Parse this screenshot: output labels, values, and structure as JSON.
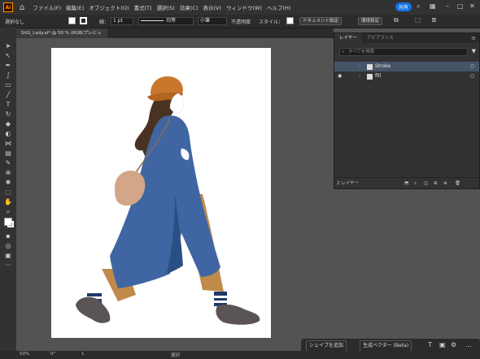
{
  "menubar": {
    "menus": [
      "ファイル(F)",
      "編集(E)",
      "オブジェクト(O)",
      "書式(T)",
      "選択(S)",
      "効果(C)",
      "表示(V)",
      "ウィンドウ(W)",
      "ヘルプ(H)"
    ],
    "share_label": "共有"
  },
  "options": {
    "selection": "選択なし",
    "stroke_label": "線：",
    "stroke_value": "1 pt",
    "profile": "均等",
    "brush": "小筆",
    "opacity_label": "不透明度",
    "style_label": "スタイル：",
    "doc_settings": "ドキュメント設定",
    "prefs": "環境設定"
  },
  "document": {
    "tab_title": "SVG_Lady.ai* @ 50 % (RGB/プレビュー)"
  },
  "layers_panel": {
    "tabs": [
      "レイヤー",
      "アピアランス"
    ],
    "search_placeholder": "すべてを検索",
    "layers": [
      {
        "name": "Stroke",
        "selected": true,
        "visible": false
      },
      {
        "name": "fill",
        "selected": false,
        "visible": true
      }
    ],
    "count": "2 レイヤー"
  },
  "context_bar": {
    "add_shape": "シェイプを追加",
    "gen_vector": "生成ベクター (Beta)"
  },
  "status": {
    "zoom": "50%",
    "angle": "0°",
    "page": "1",
    "mode": "選択"
  },
  "colors": {
    "coat": "#3f66a2",
    "pants": "#c08a4b",
    "hat": "#c9772d",
    "hair": "#4a3222",
    "bag": "#d3a68a",
    "shoes": "#5b5455",
    "accent": "#1473e6"
  }
}
